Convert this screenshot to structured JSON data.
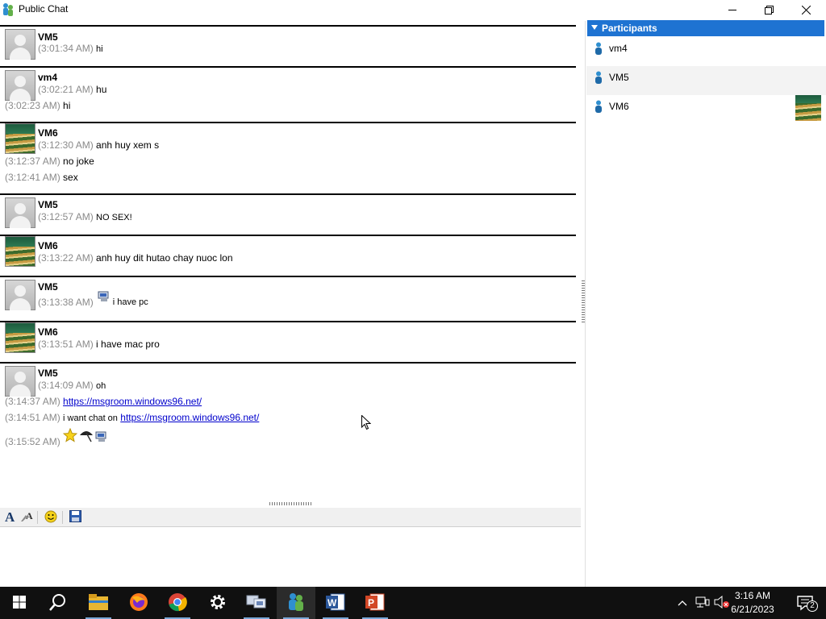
{
  "window": {
    "title": "Public Chat",
    "controls": {
      "minimize": "minimize-icon",
      "restore": "restore-icon",
      "close": "close-icon"
    }
  },
  "chat": {
    "groups": [
      {
        "sender": "VM5",
        "avatar": "default-user-avatar",
        "lines": [
          {
            "time": "(3:01:34 AM)",
            "text": "hi"
          }
        ]
      },
      {
        "sender": "vm4",
        "avatar": "default-user-avatar",
        "lines": [
          {
            "time": "(3:02:21 AM)",
            "text": "hu"
          },
          {
            "time": "(3:02:23 AM)",
            "text": "hi"
          }
        ]
      },
      {
        "sender": "VM6",
        "avatar": "stairs-photo-avatar",
        "lines": [
          {
            "time": "(3:12:30 AM)",
            "text": "anh huy xem s"
          },
          {
            "time": "(3:12:37 AM)",
            "text": "no joke"
          },
          {
            "time": "(3:12:41 AM)",
            "text": "sex"
          }
        ]
      },
      {
        "sender": "VM5",
        "avatar": "default-user-avatar",
        "lines": [
          {
            "time": "(3:12:57 AM)",
            "text": "NO SEX!"
          }
        ]
      },
      {
        "sender": "VM6",
        "avatar": "stairs-photo-avatar",
        "lines": [
          {
            "time": "(3:13:22 AM)",
            "text": "anh huy dit hutao chay nuoc lon"
          }
        ]
      },
      {
        "sender": "VM5",
        "avatar": "default-user-avatar",
        "lines": [
          {
            "time": "(3:13:38 AM)",
            "emoticon": "computer-emoticon",
            "text": "i have pc"
          }
        ]
      },
      {
        "sender": "VM6",
        "avatar": "stairs-photo-avatar",
        "lines": [
          {
            "time": "(3:13:51 AM)",
            "text": "i have mac pro"
          }
        ]
      },
      {
        "sender": "VM5",
        "avatar": "default-user-avatar",
        "lines": [
          {
            "time": "(3:14:09 AM)",
            "text": "oh"
          },
          {
            "time": "(3:14:37 AM)",
            "link": "https://msgroom.windows96.net/"
          },
          {
            "time": "(3:14:51 AM)",
            "text": "i want chat on",
            "link": "https://msgroom.windows96.net/"
          },
          {
            "time": "(3:15:52 AM)",
            "emoticons": [
              "star-emoticon",
              "umbrella-emoticon",
              "computer-emoticon"
            ]
          }
        ]
      }
    ]
  },
  "toolbar": {
    "buttons": [
      "font-icon",
      "font-color-icon",
      "smiley-icon",
      "save-icon"
    ]
  },
  "participants": {
    "header": "Participants",
    "list": [
      {
        "name": "vm4",
        "has_avatar": false
      },
      {
        "name": "VM5",
        "has_avatar": false
      },
      {
        "name": "VM6",
        "has_avatar": true
      }
    ]
  },
  "taskbar": {
    "apps": [
      "windows-start-icon",
      "search-icon",
      "file-explorer-icon",
      "firefox-icon",
      "chrome-icon",
      "settings-icon",
      "network-app-icon",
      "chat-app-icon",
      "word-icon",
      "powerpoint-icon"
    ],
    "clock_time": "3:16 AM",
    "clock_date": "6/21/2023",
    "notification_count": "2"
  },
  "colors": {
    "accent": "#1e73d2",
    "link": "#0000cc",
    "timestamp": "#8a8a8a",
    "taskbar": "#101010"
  }
}
